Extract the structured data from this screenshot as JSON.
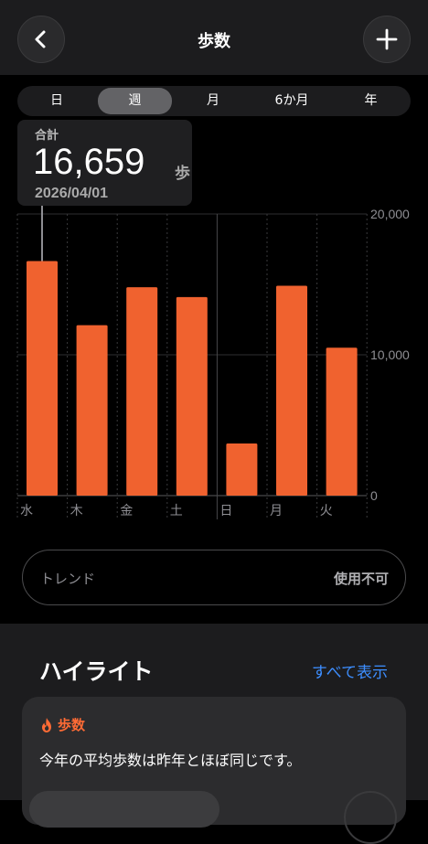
{
  "header": {
    "title": "歩数",
    "back_icon": "chevron-left-icon",
    "add_icon": "plus-icon"
  },
  "segments": [
    {
      "label": "日",
      "selected": false
    },
    {
      "label": "週",
      "selected": true
    },
    {
      "label": "月",
      "selected": false
    },
    {
      "label": "6か月",
      "selected": false
    },
    {
      "label": "年",
      "selected": false
    }
  ],
  "tooltip": {
    "label": "合計",
    "value": "16,659",
    "unit": "歩",
    "date": "2026/04/01"
  },
  "chart_data": {
    "type": "bar",
    "categories": [
      "水",
      "木",
      "金",
      "土",
      "日",
      "月",
      "火"
    ],
    "values": [
      16659,
      12100,
      14800,
      14100,
      3700,
      14900,
      10500
    ],
    "ylim": [
      0,
      20000
    ],
    "y_ticks": [
      "20,000",
      "10,000",
      "0"
    ],
    "selected_index": 0,
    "bar_color": "#f0622f",
    "grid": true,
    "y_axis_position": "right"
  },
  "trend": {
    "label": "トレンド",
    "status": "使用不可"
  },
  "highlights": {
    "title": "ハイライト",
    "see_all": "すべて表示",
    "card": {
      "icon": "flame-icon",
      "category": "歩数",
      "text": "今年の平均歩数は昨年とほぼ同じです。"
    }
  },
  "colors": {
    "accent": "#f0622f",
    "link": "#3d8eff",
    "background": "#000000"
  }
}
